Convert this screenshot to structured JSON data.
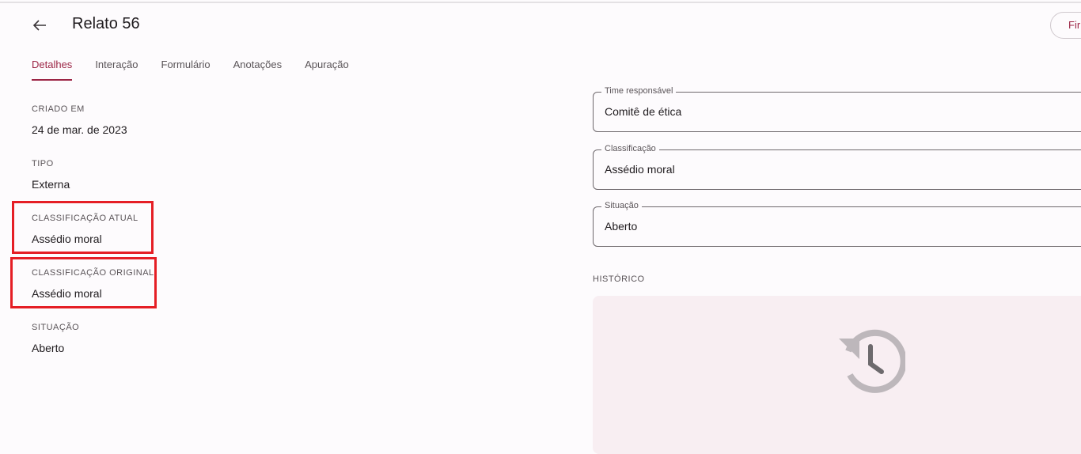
{
  "header": {
    "title": "Relato 56",
    "finish_label": "Fir"
  },
  "tabs": [
    {
      "label": "Detalhes"
    },
    {
      "label": "Interação"
    },
    {
      "label": "Formulário"
    },
    {
      "label": "Anotações"
    },
    {
      "label": "Apuração"
    }
  ],
  "details": {
    "created_label": "CRIADO EM",
    "created_value": "24 de mar. de 2023",
    "type_label": "TIPO",
    "type_value": "Externa",
    "current_class_label": "CLASSIFICAÇÃO ATUAL",
    "current_class_value": "Assédio moral",
    "original_class_label": "CLASSIFICAÇÃO ORIGINAL",
    "original_class_value": "Assédio moral",
    "status_label": "SITUAÇÃO",
    "status_value": "Aberto"
  },
  "form": {
    "team_label": "Time responsável",
    "team_value": "Comitê de ética",
    "class_label": "Classificação",
    "class_value": "Assédio moral",
    "status_label": "Situação",
    "status_value": "Aberto"
  },
  "history": {
    "label": "HISTÓRICO",
    "icon": "history-icon"
  },
  "colors": {
    "accent": "#9c2545",
    "highlight": "#e51e25",
    "history_bg": "#f8eef2"
  }
}
